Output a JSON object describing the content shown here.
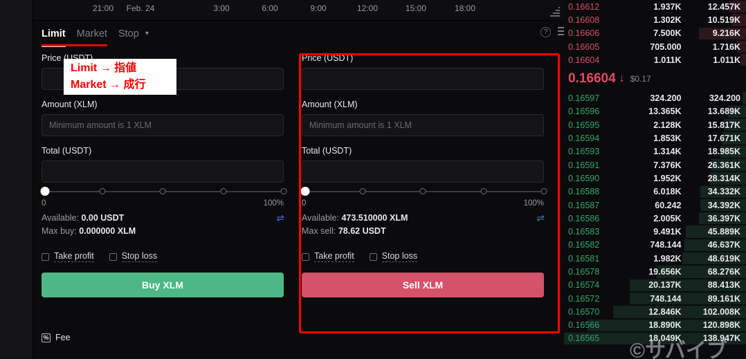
{
  "chart": {
    "time_ticks": [
      "21:00",
      "Feb. 24",
      "3:00",
      "6:00",
      "9:00",
      "12:00",
      "15:00",
      "18:00"
    ],
    "resize_grip": "resize-grip"
  },
  "tabs": {
    "items": [
      {
        "label": "Limit",
        "active": true
      },
      {
        "label": "Market",
        "active": false
      },
      {
        "label": "Stop",
        "active": false,
        "chevron": "⌄"
      }
    ],
    "help_icon": "?",
    "menu_icon": "list-icon"
  },
  "annotation": {
    "callout_line1": "Limit → 指値",
    "callout_line2": "Market → 成行",
    "color": "#ff0000",
    "background": "#ffffff"
  },
  "buy_form": {
    "price_label": "Price (USDT)",
    "price_value": "",
    "price_placeholder": "",
    "amount_label": "Amount (XLM)",
    "amount_value": "",
    "amount_placeholder": "Minimum amount is 1 XLM",
    "total_label": "Total (USDT)",
    "total_value": "",
    "total_placeholder": "",
    "slider_min": "0",
    "slider_max": "100%",
    "slider_position": 0,
    "available_label": "Available:",
    "available_value": "0.00 USDT",
    "max_label": "Max buy:",
    "max_value": "0.000000 XLM",
    "swap_icon": "⇌",
    "take_profit": "Take profit",
    "stop_loss": "Stop loss",
    "submit_label": "Buy XLM",
    "submit_color": "#4db786"
  },
  "sell_form": {
    "price_label": "Price (USDT)",
    "price_value": "",
    "price_placeholder": "",
    "amount_label": "Amount (XLM)",
    "amount_value": "",
    "amount_placeholder": "Minimum amount is 1 XLM",
    "total_label": "Total (USDT)",
    "total_value": "",
    "total_placeholder": "",
    "slider_min": "0",
    "slider_max": "100%",
    "slider_position": 0,
    "available_label": "Available:",
    "available_value": "473.510000 XLM",
    "max_label": "Max sell:",
    "max_value": "78.62 USDT",
    "swap_icon": "⇌",
    "take_profit": "Take profit",
    "stop_loss": "Stop loss",
    "submit_label": "Sell XLM",
    "submit_color": "#d4526a"
  },
  "fee": {
    "icon": "percent-icon",
    "icon_glyph": "%",
    "label": "Fee"
  },
  "orderbook": {
    "ask_color": "#d4526a",
    "bid_color": "#2fa86b",
    "asks": [
      {
        "price": "0.16612",
        "amount": "1.937K",
        "total": "12.457K",
        "depth": 9
      },
      {
        "price": "0.16608",
        "amount": "1.302K",
        "total": "10.519K",
        "depth": 8
      },
      {
        "price": "0.16606",
        "amount": "7.500K",
        "total": "9.216K",
        "depth": 26
      },
      {
        "price": "0.16605",
        "amount": "705.000",
        "total": "1.716K",
        "depth": 5
      },
      {
        "price": "0.16604",
        "amount": "1.011K",
        "total": "1.011K",
        "depth": 3
      }
    ],
    "last_price": "0.16604",
    "last_arrow": "↓",
    "last_usd": "$0.17",
    "bids": [
      {
        "price": "0.16597",
        "amount": "324.200",
        "total": "324.200",
        "depth": 2
      },
      {
        "price": "0.16596",
        "amount": "13.365K",
        "total": "13.689K",
        "depth": 10
      },
      {
        "price": "0.16595",
        "amount": "2.128K",
        "total": "15.817K",
        "depth": 12
      },
      {
        "price": "0.16594",
        "amount": "1.853K",
        "total": "17.671K",
        "depth": 13
      },
      {
        "price": "0.16593",
        "amount": "1.314K",
        "total": "18.985K",
        "depth": 14
      },
      {
        "price": "0.16591",
        "amount": "7.376K",
        "total": "26.361K",
        "depth": 19
      },
      {
        "price": "0.16590",
        "amount": "1.952K",
        "total": "28.314K",
        "depth": 20
      },
      {
        "price": "0.16588",
        "amount": "6.018K",
        "total": "34.332K",
        "depth": 25
      },
      {
        "price": "0.16587",
        "amount": "60.242",
        "total": "34.392K",
        "depth": 25
      },
      {
        "price": "0.16586",
        "amount": "2.005K",
        "total": "36.397K",
        "depth": 26
      },
      {
        "price": "0.16583",
        "amount": "9.491K",
        "total": "45.889K",
        "depth": 33
      },
      {
        "price": "0.16582",
        "amount": "748.144",
        "total": "46.637K",
        "depth": 34
      },
      {
        "price": "0.16581",
        "amount": "1.982K",
        "total": "48.619K",
        "depth": 35
      },
      {
        "price": "0.16578",
        "amount": "19.656K",
        "total": "68.276K",
        "depth": 49
      },
      {
        "price": "0.16574",
        "amount": "20.137K",
        "total": "88.413K",
        "depth": 64
      },
      {
        "price": "0.16572",
        "amount": "748.144",
        "total": "89.161K",
        "depth": 64
      },
      {
        "price": "0.16570",
        "amount": "12.846K",
        "total": "102.008K",
        "depth": 73
      },
      {
        "price": "0.16566",
        "amount": "18.890K",
        "total": "120.898K",
        "depth": 87
      },
      {
        "price": "0.16565",
        "amount": "18.049K",
        "total": "138.947K",
        "depth": 100
      }
    ]
  },
  "watermark": {
    "text": "©サバイブ"
  }
}
